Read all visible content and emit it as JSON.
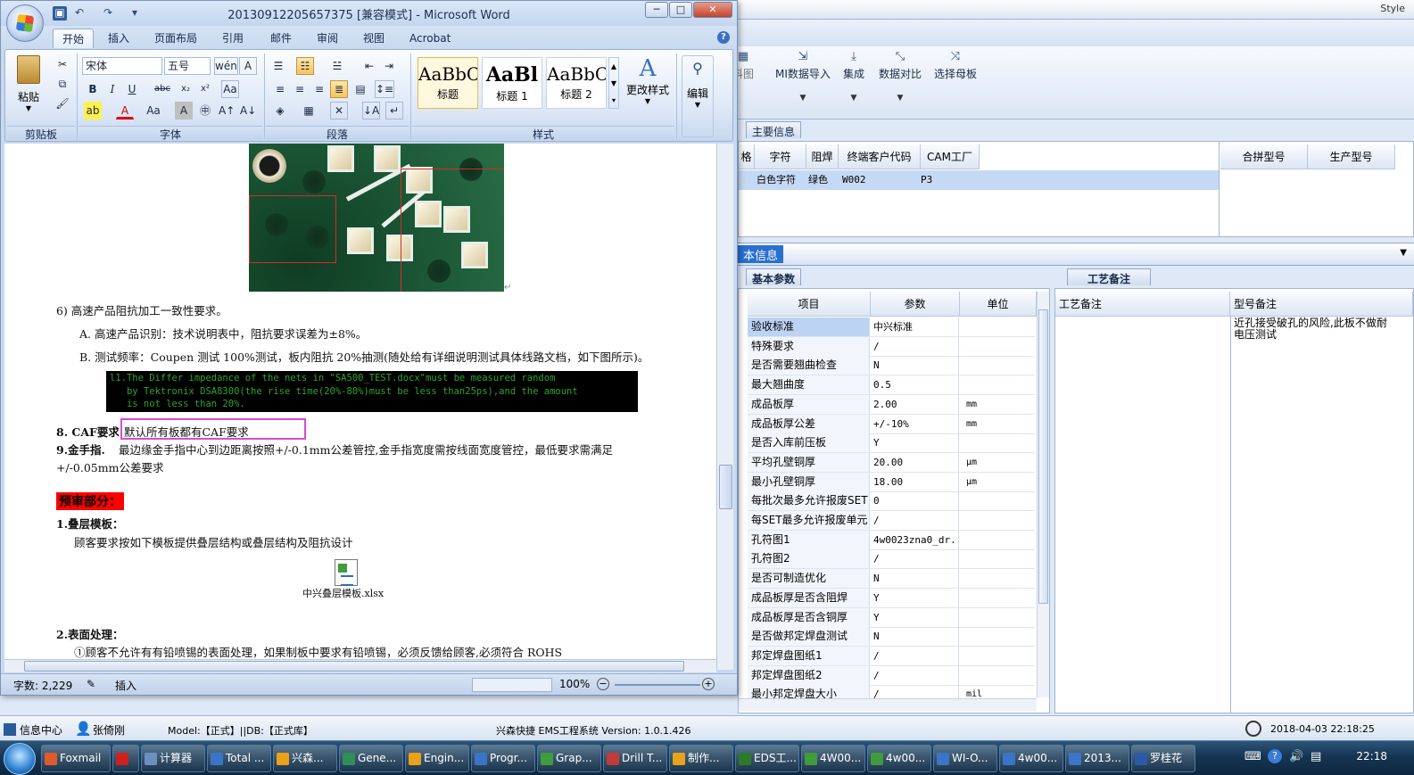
{
  "ems": {
    "style_label": "Style",
    "ribbon_buttons": [
      {
        "label": "料图",
        "icon": "partial-icon"
      },
      {
        "label": "MI数据导入",
        "icon": "import-icon"
      },
      {
        "label": "集成",
        "icon": "integrate-icon"
      },
      {
        "label": "数据对比",
        "icon": "compare-icon"
      },
      {
        "label": "选择母板",
        "icon": "select-board-icon"
      }
    ],
    "main_panel_tab": "主要信息",
    "main_grid_headers": [
      "格",
      "字符",
      "阻焊",
      "终端客户代码",
      "CAM工厂"
    ],
    "main_grid_headers_right": [
      "合拼型号",
      "生产型号"
    ],
    "main_grid_row": {
      "char": "白色字符",
      "mask": "绿色",
      "customer": "W002",
      "factory": "P3"
    },
    "info_bar_title": "本信息",
    "basic_tab": "基本参数",
    "basic_headers": {
      "item": "项目",
      "param": "参数",
      "unit": "单位"
    },
    "params": [
      {
        "name": "验收标准",
        "value": "中兴标准",
        "unit": ""
      },
      {
        "name": "特殊要求",
        "value": "/",
        "unit": ""
      },
      {
        "name": "是否需要翘曲检查",
        "value": "N",
        "unit": ""
      },
      {
        "name": "最大翘曲度",
        "value": "0.5",
        "unit": ""
      },
      {
        "name": "成品板厚",
        "value": "2.00",
        "unit": "mm"
      },
      {
        "name": "成品板厚公差",
        "value": "+/-10%",
        "unit": "mm"
      },
      {
        "name": "是否入库前压板",
        "value": "Y",
        "unit": ""
      },
      {
        "name": "平均孔壁铜厚",
        "value": "20.00",
        "unit": "μm"
      },
      {
        "name": "最小孔壁铜厚",
        "value": "18.00",
        "unit": "μm"
      },
      {
        "name": "每批次最多允许报废SET",
        "value": "0",
        "unit": ""
      },
      {
        "name": "每SET最多允许报废单元",
        "value": "/",
        "unit": ""
      },
      {
        "name": "孔符图1",
        "value": "4w0023zna0_dr...",
        "unit": ""
      },
      {
        "name": "孔符图2",
        "value": "/",
        "unit": ""
      },
      {
        "name": "是否可制造优化",
        "value": "N",
        "unit": ""
      },
      {
        "name": "成品板厚是否含阻焊",
        "value": "Y",
        "unit": ""
      },
      {
        "name": "成品板厚是否含铜厚",
        "value": "Y",
        "unit": ""
      },
      {
        "name": "是否做邦定焊盘测试",
        "value": "N",
        "unit": ""
      },
      {
        "name": "邦定焊盘图纸1",
        "value": "/",
        "unit": ""
      },
      {
        "name": "邦定焊盘图纸2",
        "value": "/",
        "unit": ""
      },
      {
        "name": "最小邦定焊盘大小",
        "value": "/",
        "unit": "mil"
      }
    ],
    "craft_tab": "工艺备注",
    "craft_headers": {
      "left": "工艺备注",
      "right": "型号备注"
    },
    "model_note": "近孔接受破孔的风险,此板不做耐电压测试",
    "status": {
      "info_center": "信息中心",
      "user": "张倚刚",
      "model_db": "Model:【正式】||DB:【正式库】",
      "system": "兴森快捷 EMS工程系统 Version: 1.0.1.426",
      "datetime": "2018-04-03 22:18:25"
    }
  },
  "word": {
    "title": "20130912205657375 [兼容模式] - Microsoft Word",
    "tabs": [
      "开始",
      "插入",
      "页面布局",
      "引用",
      "邮件",
      "审阅",
      "视图",
      "Acrobat"
    ],
    "font_name": "宋体",
    "font_size": "五号",
    "groups": {
      "clipboard": "剪贴板",
      "font": "字体",
      "paragraph": "段落",
      "styles": "样式"
    },
    "paste_label": "粘贴",
    "styles": [
      {
        "sample": "AaBbC",
        "name": "标题"
      },
      {
        "sample": "AaBl",
        "name": "标题 1"
      },
      {
        "sample": "AaBbC",
        "name": "标题 2"
      }
    ],
    "change_styles": "更改样式",
    "edit_label": "编辑",
    "doc": {
      "line6": "6) 高速产品阻抗加工一致性要求。",
      "lineA": "A. 高速产品识别：技术说明表中，阻抗要求误差为±8%。",
      "lineB": "B. 测试频率：Coupen 测试 100%测试，板内阻抗 20%抽测(随处给有详细说明测试具体线路文档，如下图所示)。",
      "code": "l1.The Differ impedance of the nets in \"SA500_TEST.docx\"must be measured random\n   by Tektronix DSA8300(the rise time(20%-80%)must be less than25ps),and the amount\n   is not less than 20%.",
      "caf_label": "8. CAF要求",
      "caf_text": "默认所有板都有CAF要求",
      "gold_label": "9.金手指.",
      "gold_text": "最边缘金手指中心到边距离按照+/-0.1mm公差管控,金手指宽度需按线面宽度管控，最低要求需满足",
      "gold_text2": "+/-0.05mm公差要求",
      "pre_review": "预审部分：",
      "stack_title": "1.叠层模板：",
      "stack_text": "顾客要求按如下模板提供叠层结构或叠层结构及阻抗设计",
      "xlsx_name": "中兴叠层模板.xlsx",
      "surface_title": "2.表面处理：",
      "surface_text": "①顾客不允许有有铅喷锡的表面处理，如果制板中要求有铅喷锡，必须反馈给顾客,必须符合 ROHS"
    },
    "status": {
      "words": "字数: 2,229",
      "mode": "插入",
      "zoom": "100%"
    }
  },
  "taskbar": {
    "items": [
      "Foxmail",
      "",
      "计算器",
      "Total ...",
      "兴森...",
      "Gene...",
      "Engin...",
      "Progr...",
      "Grap...",
      "Drill T...",
      "制作...",
      "EDS工...",
      "4W00...",
      "4w00...",
      "WI-O...",
      "4w00...",
      "2013...",
      "罗桂花"
    ],
    "clock": "22:18"
  }
}
